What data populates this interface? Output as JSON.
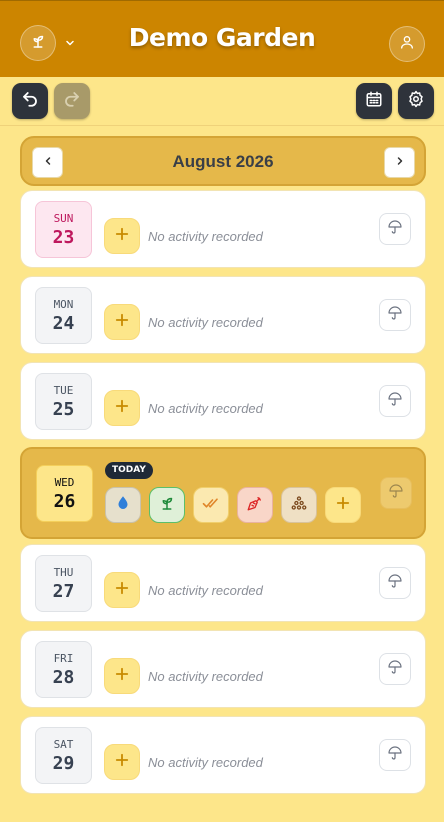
{
  "app": {
    "title": "Demo Garden"
  },
  "header": {
    "garden_icon": "sprout-icon",
    "dropdown_icon": "chevron-down-icon",
    "profile_icon": "user-icon"
  },
  "toolbar": {
    "undo_icon": "undo-icon",
    "redo_icon": "redo-icon",
    "calendar_icon": "calendar-icon",
    "settings_icon": "gear-icon"
  },
  "month_nav": {
    "label": "August 2026",
    "prev_icon": "chevron-left-icon",
    "next_icon": "chevron-right-icon"
  },
  "days": [
    {
      "dow": "SUN",
      "num": "23",
      "status": "No activity recorded"
    },
    {
      "dow": "MON",
      "num": "24",
      "status": "No activity recorded"
    },
    {
      "dow": "TUE",
      "num": "25",
      "status": "No activity recorded"
    },
    {
      "dow": "WED",
      "num": "26",
      "badge": "TODAY",
      "activities": [
        "water-drop-icon",
        "sprout-icon",
        "double-check-icon",
        "carrot-icon",
        "seeds-icon"
      ]
    },
    {
      "dow": "THU",
      "num": "27",
      "status": "No activity recorded"
    },
    {
      "dow": "FRI",
      "num": "28",
      "status": "No activity recorded"
    },
    {
      "dow": "SAT",
      "num": "29",
      "status": "No activity recorded"
    }
  ],
  "colors": {
    "header": "#cc8500",
    "background": "#fde68a",
    "today_card": "#e5b84a",
    "dark_button": "#2e333b"
  }
}
